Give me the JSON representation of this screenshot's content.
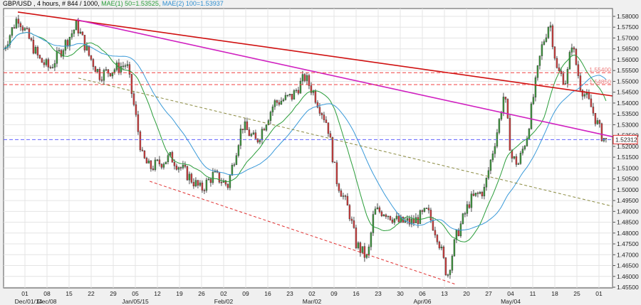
{
  "header": {
    "symbol_info": "GBP/USD , 4 hours, # 844 / 1000, ",
    "ma1": "MAE(1) 50=1.53525,",
    "ma2": "MAE(2) 100=1.53937"
  },
  "chart_data": {
    "type": "candlestick",
    "title": "GBP/USD , 4 hours",
    "ylim": [
      1.453,
      1.584
    ],
    "xlim_weeks": [
      -0.97,
      26.6
    ],
    "y_ticks": [
      "1.58000",
      "1.57500",
      "1.57000",
      "1.56500",
      "1.56000",
      "1.55500",
      "1.55000",
      "1.54500",
      "1.54000",
      "1.53500",
      "1.53000",
      "1.52500",
      "1.52000",
      "1.51500",
      "1.51000",
      "1.50500",
      "1.50000",
      "1.49500",
      "1.49000",
      "1.48500",
      "1.48000",
      "1.47500",
      "1.47000",
      "1.46500",
      "1.46000",
      "1.45500"
    ],
    "x_ticks_day": [
      "01",
      "08",
      "15",
      "22",
      "29",
      "05",
      "12",
      "19",
      "26",
      "02",
      "09",
      "16",
      "23",
      "02",
      "09",
      "16",
      "23",
      "30",
      "06",
      "13",
      "20",
      "27",
      "04",
      "11",
      "18",
      "25",
      "01"
    ],
    "x_ticks_month": [
      {
        "label": "Dec/01/14",
        "week": 0
      },
      {
        "label": "Dec/08",
        "week": 1
      },
      {
        "label": "Jan/05/15",
        "week": 5
      },
      {
        "label": "Feb/02",
        "week": 9
      },
      {
        "label": "Mar/02",
        "week": 13
      },
      {
        "label": "Apr/06",
        "week": 18
      },
      {
        "label": "May/04",
        "week": 22
      }
    ],
    "price_path": [
      [
        -0.97,
        1.565
      ],
      [
        -0.32,
        1.58
      ],
      [
        0.65,
        1.56
      ],
      [
        1.13,
        1.556
      ],
      [
        2.35,
        1.576
      ],
      [
        2.9,
        1.562
      ],
      [
        3.39,
        1.553
      ],
      [
        4.61,
        1.558
      ],
      [
        5.0,
        1.535
      ],
      [
        5.32,
        1.515
      ],
      [
        5.65,
        1.51
      ],
      [
        6.61,
        1.515
      ],
      [
        7.26,
        1.508
      ],
      [
        7.97,
        1.5
      ],
      [
        8.55,
        1.507
      ],
      [
        9.19,
        1.502
      ],
      [
        9.84,
        1.53
      ],
      [
        10.48,
        1.522
      ],
      [
        11.29,
        1.54
      ],
      [
        12.1,
        1.543
      ],
      [
        12.68,
        1.552
      ],
      [
        13.06,
        1.545
      ],
      [
        13.71,
        1.53
      ],
      [
        14.1,
        1.505
      ],
      [
        14.68,
        1.49
      ],
      [
        15.0,
        1.475
      ],
      [
        15.52,
        1.468
      ],
      [
        15.81,
        1.49
      ],
      [
        16.29,
        1.49
      ],
      [
        16.94,
        1.485
      ],
      [
        17.58,
        1.485
      ],
      [
        18.23,
        1.49
      ],
      [
        18.71,
        1.478
      ],
      [
        19.13,
        1.46
      ],
      [
        19.52,
        1.478
      ],
      [
        20.16,
        1.495
      ],
      [
        20.81,
        1.5
      ],
      [
        21.45,
        1.53
      ],
      [
        21.71,
        1.545
      ],
      [
        22.03,
        1.515
      ],
      [
        22.35,
        1.512
      ],
      [
        22.74,
        1.525
      ],
      [
        23.39,
        1.565
      ],
      [
        23.77,
        1.578
      ],
      [
        24.1,
        1.555
      ],
      [
        24.52,
        1.55
      ],
      [
        24.77,
        1.568
      ],
      [
        25.16,
        1.548
      ],
      [
        25.65,
        1.538
      ],
      [
        26.13,
        1.525
      ],
      [
        26.35,
        1.522
      ]
    ],
    "moving_averages": [
      {
        "name": "MAE(1) 50",
        "last": 1.53525,
        "period_bars": 50,
        "color": "#2a9d3a"
      },
      {
        "name": "MAE(2) 100",
        "last": 1.53937,
        "period_bars": 100,
        "color": "#3a9ad9"
      }
    ],
    "trend_lines": [
      {
        "name": "upper-resistance",
        "color": "#d01010",
        "style": "solid",
        "from": [
          -0.32,
          1.582
        ],
        "to": [
          26.6,
          1.5433
        ]
      },
      {
        "name": "magenta-trend",
        "color": "#d020c0",
        "style": "solid",
        "from": [
          2.35,
          1.5784
        ],
        "to": [
          26.6,
          1.5245
        ]
      },
      {
        "name": "mid-channel",
        "color": "#8a8a40",
        "style": "dashed",
        "from": [
          2.42,
          1.5515
        ],
        "to": [
          26.6,
          1.4924
        ]
      },
      {
        "name": "lower-channel",
        "color": "#e03030",
        "style": "dashed",
        "from": [
          5.65,
          1.5039
        ],
        "to": [
          19.52,
          1.4563
        ]
      }
    ],
    "horizontal_levels": [
      {
        "label": "1.55400",
        "value": 1.554,
        "color": "#f04040"
      },
      {
        "label": "1.54850",
        "value": 1.5485,
        "color": "#f04040"
      }
    ],
    "current_price": {
      "label": "1.52312",
      "value": 1.52312,
      "color": "#6060ff"
    }
  }
}
